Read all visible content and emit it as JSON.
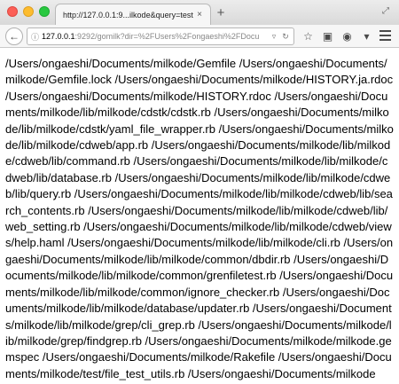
{
  "window": {
    "tab_title": "http://127.0.0.1:9...ilkode&query=test",
    "tab_close": "×",
    "new_tab": "+"
  },
  "navbar": {
    "back_arrow": "←",
    "url_host": "127.0.0.1",
    "url_path": ":9292/gomilk?dir=%2FUsers%2Fongaeshi%2FDocu",
    "url_icons": [
      "▿",
      "↻"
    ],
    "toolbar_icons": [
      "☆",
      "▣",
      "◉",
      "▾"
    ]
  },
  "content": {
    "results": "/Users/ongaeshi/Documents/milkode/Gemfile /Users/ongaeshi/Documents/milkode/Gemfile.lock /Users/ongaeshi/Documents/milkode/HISTORY.ja.rdoc /Users/ongaeshi/Documents/milkode/HISTORY.rdoc /Users/ongaeshi/Documents/milkode/lib/milkode/cdstk/cdstk.rb /Users/ongaeshi/Documents/milkode/lib/milkode/cdstk/yaml_file_wrapper.rb /Users/ongaeshi/Documents/milkode/lib/milkode/cdweb/app.rb /Users/ongaeshi/Documents/milkode/lib/milkode/cdweb/lib/command.rb /Users/ongaeshi/Documents/milkode/lib/milkode/cdweb/lib/database.rb /Users/ongaeshi/Documents/milkode/lib/milkode/cdweb/lib/query.rb /Users/ongaeshi/Documents/milkode/lib/milkode/cdweb/lib/search_contents.rb /Users/ongaeshi/Documents/milkode/lib/milkode/cdweb/lib/web_setting.rb /Users/ongaeshi/Documents/milkode/lib/milkode/cdweb/views/help.haml /Users/ongaeshi/Documents/milkode/lib/milkode/cli.rb /Users/ongaeshi/Documents/milkode/lib/milkode/common/dbdir.rb /Users/ongaeshi/Documents/milkode/lib/milkode/common/grenfiletest.rb /Users/ongaeshi/Documents/milkode/lib/milkode/common/ignore_checker.rb /Users/ongaeshi/Documents/milkode/lib/milkode/database/updater.rb /Users/ongaeshi/Documents/milkode/lib/milkode/grep/cli_grep.rb /Users/ongaeshi/Documents/milkode/lib/milkode/grep/findgrep.rb /Users/ongaeshi/Documents/milkode/milkode.gemspec /Users/ongaeshi/Documents/milkode/Rakefile /Users/ongaeshi/Documents/milkode/test/file_test_utils.rb /Users/ongaeshi/Documents/milkode"
  }
}
